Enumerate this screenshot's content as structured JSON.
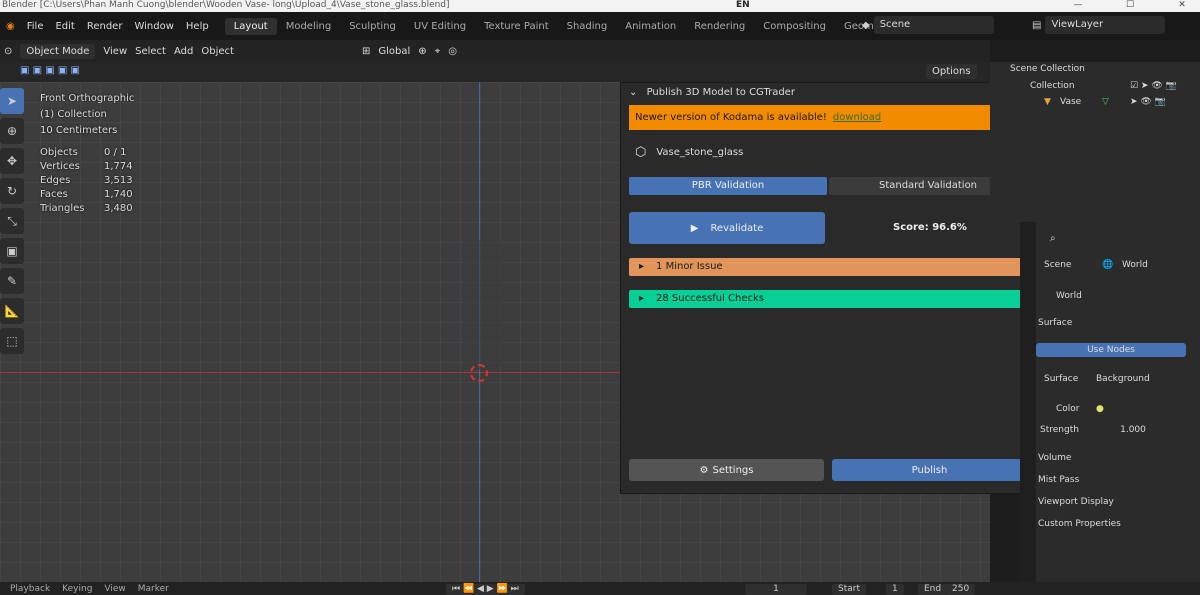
{
  "window": {
    "title": "Blender [C:\\Users\\Phan Manh Cuong\\blender\\Wooden Vase- long\\Upload_4\\Vase_stone_glass.blend]",
    "lang": "EN",
    "min": "—",
    "max": "☐",
    "close": "✕"
  },
  "menu": [
    "File",
    "Edit",
    "Render",
    "Window",
    "Help"
  ],
  "workspaces": [
    "Layout",
    "Modeling",
    "Sculpting",
    "UV Editing",
    "Texture Paint",
    "Shading",
    "Animation",
    "Rendering",
    "Compositing",
    "Geometry Nodes"
  ],
  "scene": "Scene",
  "view_layer": "ViewLayer",
  "header": {
    "mode": "Object Mode",
    "items": [
      "View",
      "Select",
      "Add",
      "Object"
    ],
    "transform": "Global",
    "options": "Options"
  },
  "viewport": {
    "view_name": "Front Orthographic",
    "collection": "(1) Collection",
    "scale": "10 Centimeters",
    "stats": [
      {
        "label": "Objects",
        "value": "0 / 1"
      },
      {
        "label": "Vertices",
        "value": "1,774"
      },
      {
        "label": "Edges",
        "value": "3,513"
      },
      {
        "label": "Faces",
        "value": "1,740"
      },
      {
        "label": "Triangles",
        "value": "3,480"
      }
    ]
  },
  "panel": {
    "title": "Publish 3D Model to CGTrader",
    "banner_text": "Newer version of Kodama is available!",
    "banner_link": "download",
    "model_name": "Vase_stone_glass",
    "tab_pbr": "PBR Validation",
    "tab_standard": "Standard Validation",
    "revalidate": "Revalidate",
    "score": "Score: 96.6%",
    "minor_issue": "1 Minor Issue",
    "successful": "28 Successful Checks",
    "settings": "Settings",
    "publish": "Publish",
    "colors": {
      "banner": "#f28b00",
      "blue": "#4772b3",
      "orange": "#e1955a",
      "green": "#07cf96"
    }
  },
  "outliner": {
    "root": "Scene Collection",
    "collection": "Collection",
    "object": "Vase"
  },
  "properties": {
    "breadcrumb_scene": "Scene",
    "breadcrumb_world": "World",
    "world_name": "World",
    "surface_header": "Surface",
    "use_nodes": "Use Nodes",
    "surface_label": "Surface",
    "surface_value": "Background",
    "color_label": "Color",
    "strength_label": "Strength",
    "strength_value": "1.000",
    "volume": "Volume",
    "mist_pass": "Mist Pass",
    "viewport_display": "Viewport Display",
    "custom_properties": "Custom Properties"
  },
  "timeline": {
    "items": [
      "Playback",
      "Keying",
      "View",
      "Marker"
    ],
    "frame": "1",
    "start_label": "Start",
    "start": "1",
    "end_label": "End",
    "end": "250"
  }
}
